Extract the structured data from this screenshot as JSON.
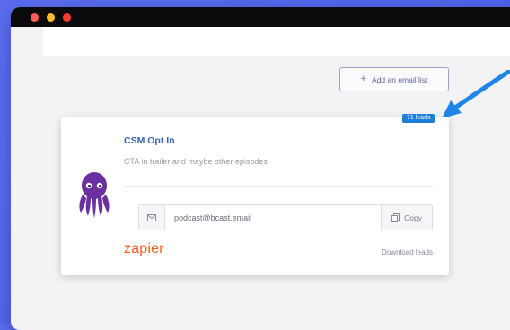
{
  "window": {
    "traffic_lights": [
      {
        "name": "close",
        "color": "#ff5f57"
      },
      {
        "name": "minimize",
        "color": "#febc2e"
      },
      {
        "name": "zoom",
        "color": "#ff3b30"
      }
    ]
  },
  "toolbar": {
    "add_list_label": "Add an email list",
    "add_icon": "plus-icon"
  },
  "leads_badge": "71 leads",
  "card": {
    "title": "CSM Opt In",
    "description": "CTA in trailer and maybe other episodes",
    "email": "podcast@bcast.email",
    "copy_label": "Copy",
    "integration": "zapier",
    "download_label": "Download leads",
    "icons": [
      "octopus-avatar-icon",
      "mail-icon",
      "copy-icon"
    ]
  },
  "colors": {
    "background": "#5163ea",
    "accent": "#1d7fd8",
    "title_blue": "#3a63b0",
    "zapier_orange": "#ff5a1f",
    "octopus_purple": "#6b2fa0"
  }
}
